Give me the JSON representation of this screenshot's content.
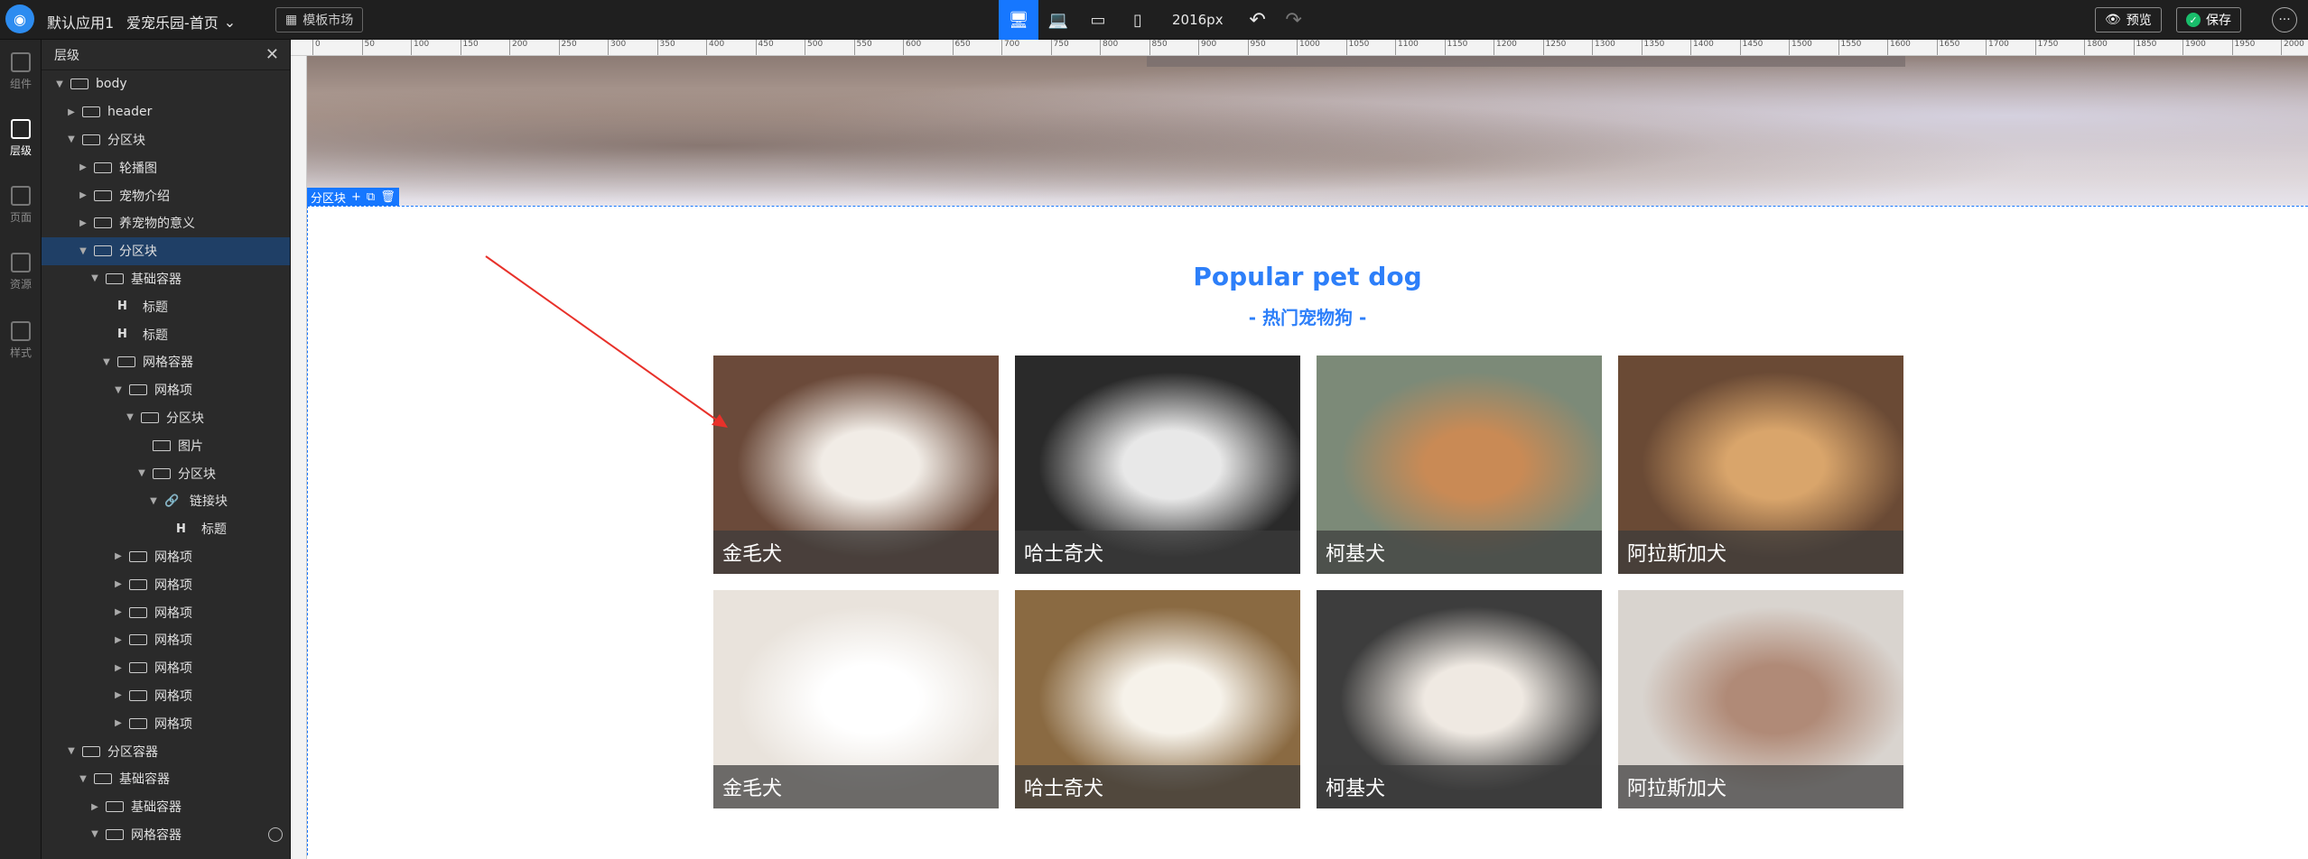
{
  "topbar": {
    "app_name": "默认应用1",
    "page_name": "爱宠乐园-首页",
    "template_market": "模板市场",
    "width_label": "2016px",
    "preview": "预览",
    "save": "保存"
  },
  "rail": {
    "components": "组件",
    "layers": "层级",
    "pages": "页面",
    "assets": "资源",
    "styles": "样式"
  },
  "layers": {
    "title": "层级",
    "rows": [
      {
        "label": "body",
        "depth": 0,
        "caret": "▼",
        "icon": "box"
      },
      {
        "label": "header",
        "depth": 1,
        "caret": "▶",
        "icon": "box"
      },
      {
        "label": "分区块",
        "depth": 1,
        "caret": "▼",
        "icon": "box"
      },
      {
        "label": "轮播图",
        "depth": 2,
        "caret": "▶",
        "icon": "box"
      },
      {
        "label": "宠物介绍",
        "depth": 2,
        "caret": "▶",
        "icon": "box"
      },
      {
        "label": "养宠物的意义",
        "depth": 2,
        "caret": "▶",
        "icon": "box"
      },
      {
        "label": "分区块",
        "depth": 2,
        "caret": "▼",
        "icon": "box",
        "selected": true
      },
      {
        "label": "基础容器",
        "depth": 3,
        "caret": "▼",
        "icon": "box"
      },
      {
        "label": "标题",
        "depth": 4,
        "caret": "",
        "icon": "text"
      },
      {
        "label": "标题",
        "depth": 4,
        "caret": "",
        "icon": "text"
      },
      {
        "label": "网格容器",
        "depth": 4,
        "caret": "▼",
        "icon": "box"
      },
      {
        "label": "网格项",
        "depth": 5,
        "caret": "▼",
        "icon": "box"
      },
      {
        "label": "分区块",
        "depth": 6,
        "caret": "▼",
        "icon": "box"
      },
      {
        "label": "图片",
        "depth": 7,
        "caret": "",
        "icon": "img"
      },
      {
        "label": "分区块",
        "depth": 7,
        "caret": "▼",
        "icon": "box"
      },
      {
        "label": "链接块",
        "depth": 8,
        "caret": "▼",
        "icon": "link"
      },
      {
        "label": "标题",
        "depth": 9,
        "caret": "",
        "icon": "text"
      },
      {
        "label": "网格项",
        "depth": 5,
        "caret": "▶",
        "icon": "box"
      },
      {
        "label": "网格项",
        "depth": 5,
        "caret": "▶",
        "icon": "box"
      },
      {
        "label": "网格项",
        "depth": 5,
        "caret": "▶",
        "icon": "box"
      },
      {
        "label": "网格项",
        "depth": 5,
        "caret": "▶",
        "icon": "box"
      },
      {
        "label": "网格项",
        "depth": 5,
        "caret": "▶",
        "icon": "box"
      },
      {
        "label": "网格项",
        "depth": 5,
        "caret": "▶",
        "icon": "box"
      },
      {
        "label": "网格项",
        "depth": 5,
        "caret": "▶",
        "icon": "box"
      },
      {
        "label": "分区容器",
        "depth": 1,
        "caret": "▼",
        "icon": "box"
      },
      {
        "label": "基础容器",
        "depth": 2,
        "caret": "▼",
        "icon": "box"
      },
      {
        "label": "基础容器",
        "depth": 3,
        "caret": "▶",
        "icon": "box"
      },
      {
        "label": "网格容器",
        "depth": 3,
        "caret": "▼",
        "icon": "box",
        "extra": true
      }
    ]
  },
  "ruler": {
    "ticks": [
      "0",
      "50",
      "100",
      "150",
      "200",
      "250",
      "300",
      "350",
      "400",
      "450",
      "500",
      "550",
      "600",
      "650",
      "700",
      "750",
      "800",
      "850",
      "900",
      "950",
      "1000",
      "1050",
      "1100",
      "1150",
      "1200",
      "1250",
      "1300",
      "1350",
      "1400",
      "1450",
      "1500",
      "1550",
      "1600",
      "1650",
      "1700",
      "1750",
      "1800",
      "1850",
      "1900",
      "1950",
      "2000"
    ]
  },
  "canvas": {
    "selection_label": "分区块",
    "section_title": "Popular pet dog",
    "section_subtitle": "- 热门宠物狗 -",
    "cards": [
      {
        "caption": "金毛犬",
        "bg": "#6b4a3a",
        "fg": "#f1ece6"
      },
      {
        "caption": "哈士奇犬",
        "bg": "#2a2a2a",
        "fg": "#e8e8e8"
      },
      {
        "caption": "柯基犬",
        "bg": "#7c8a78",
        "fg": "#c98a55"
      },
      {
        "caption": "阿拉斯加犬",
        "bg": "#6a4a35",
        "fg": "#d9a56b"
      },
      {
        "caption": "金毛犬",
        "bg": "#e9e3dc",
        "fg": "#ffffff"
      },
      {
        "caption": "哈士奇犬",
        "bg": "#8a6a42",
        "fg": "#f6f2ea"
      },
      {
        "caption": "柯基犬",
        "bg": "#3d3d3d",
        "fg": "#efe9e2"
      },
      {
        "caption": "阿拉斯加犬",
        "bg": "#d9d4cf",
        "fg": "#b08a77"
      }
    ]
  }
}
